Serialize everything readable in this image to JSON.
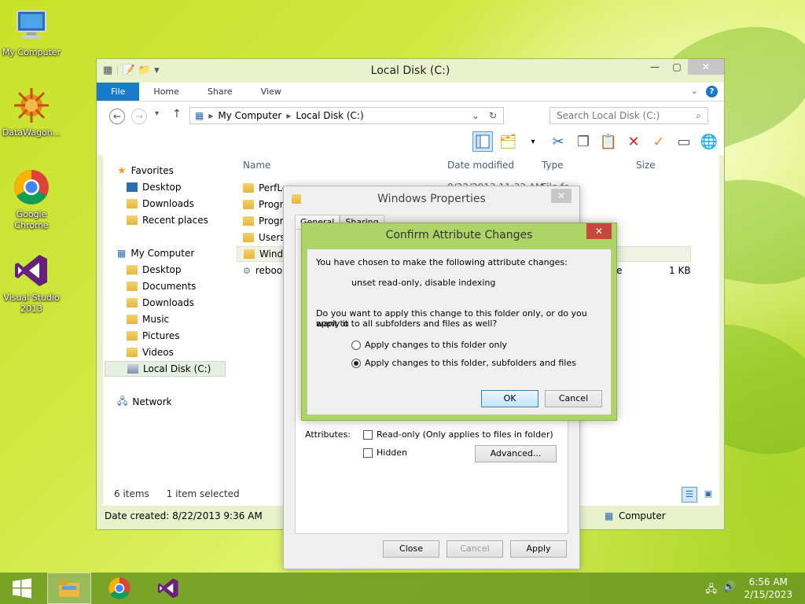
{
  "desktop": {
    "icons": [
      {
        "label": "My Computer"
      },
      {
        "label": "DataWagon..."
      },
      {
        "label": "Google Chrome"
      },
      {
        "label": "Visual Studio 2013"
      }
    ]
  },
  "explorer": {
    "title": "Local Disk (C:)",
    "ribbon_tabs": [
      "File",
      "Home",
      "Share",
      "View"
    ],
    "address": {
      "root": "My Computer",
      "current": "Local Disk (C:)"
    },
    "search_placeholder": "Search Local Disk (C:)",
    "columns": [
      "Name",
      "Date modified",
      "Type",
      "Size"
    ],
    "files": [
      {
        "name": "PerfLo",
        "date": "8/22/2013 11:33 AM",
        "type": "File fo"
      },
      {
        "name": "Progra"
      },
      {
        "name": "Progra"
      },
      {
        "name": "Users"
      },
      {
        "name": "Windo"
      },
      {
        "name": "reboo",
        "type": "e",
        "size": "1 KB"
      }
    ],
    "nav": {
      "favorites": "Favorites",
      "fav_items": [
        "Desktop",
        "Downloads",
        "Recent places"
      ],
      "computer": "My Computer",
      "comp_items": [
        "Desktop",
        "Documents",
        "Downloads",
        "Music",
        "Pictures",
        "Videos",
        "Local Disk (C:)"
      ],
      "network": "Network"
    },
    "status": {
      "count": "6 items",
      "selected": "1 item selected",
      "created": "Date created: 8/22/2013 9:36 AM",
      "location": "Computer"
    }
  },
  "properties": {
    "title": "Windows Properties",
    "tabs": [
      "General",
      "Sharing"
    ],
    "attributes_label": "Attributes:",
    "readonly_label": "Read-only (Only applies to files in folder)",
    "hidden_label": "Hidden",
    "advanced_button": "Advanced...",
    "close_button": "Close",
    "cancel_button": "Cancel",
    "apply_button": "Apply"
  },
  "confirm": {
    "title": "Confirm Attribute Changes",
    "intro": "You have chosen to make the following attribute changes:",
    "changes": "unset read-only, disable indexing",
    "question_line1": "Do you want to apply this change to this folder only, or do you want to",
    "question_line2": "apply it to all subfolders and files as well?",
    "option_folder_only": "Apply changes to this folder only",
    "option_all": "Apply changes to this folder, subfolders and files",
    "selected_option": "option_all",
    "ok_button": "OK",
    "cancel_button": "Cancel"
  },
  "taskbar": {
    "time": "6:56 AM",
    "date": "2/15/2023"
  }
}
